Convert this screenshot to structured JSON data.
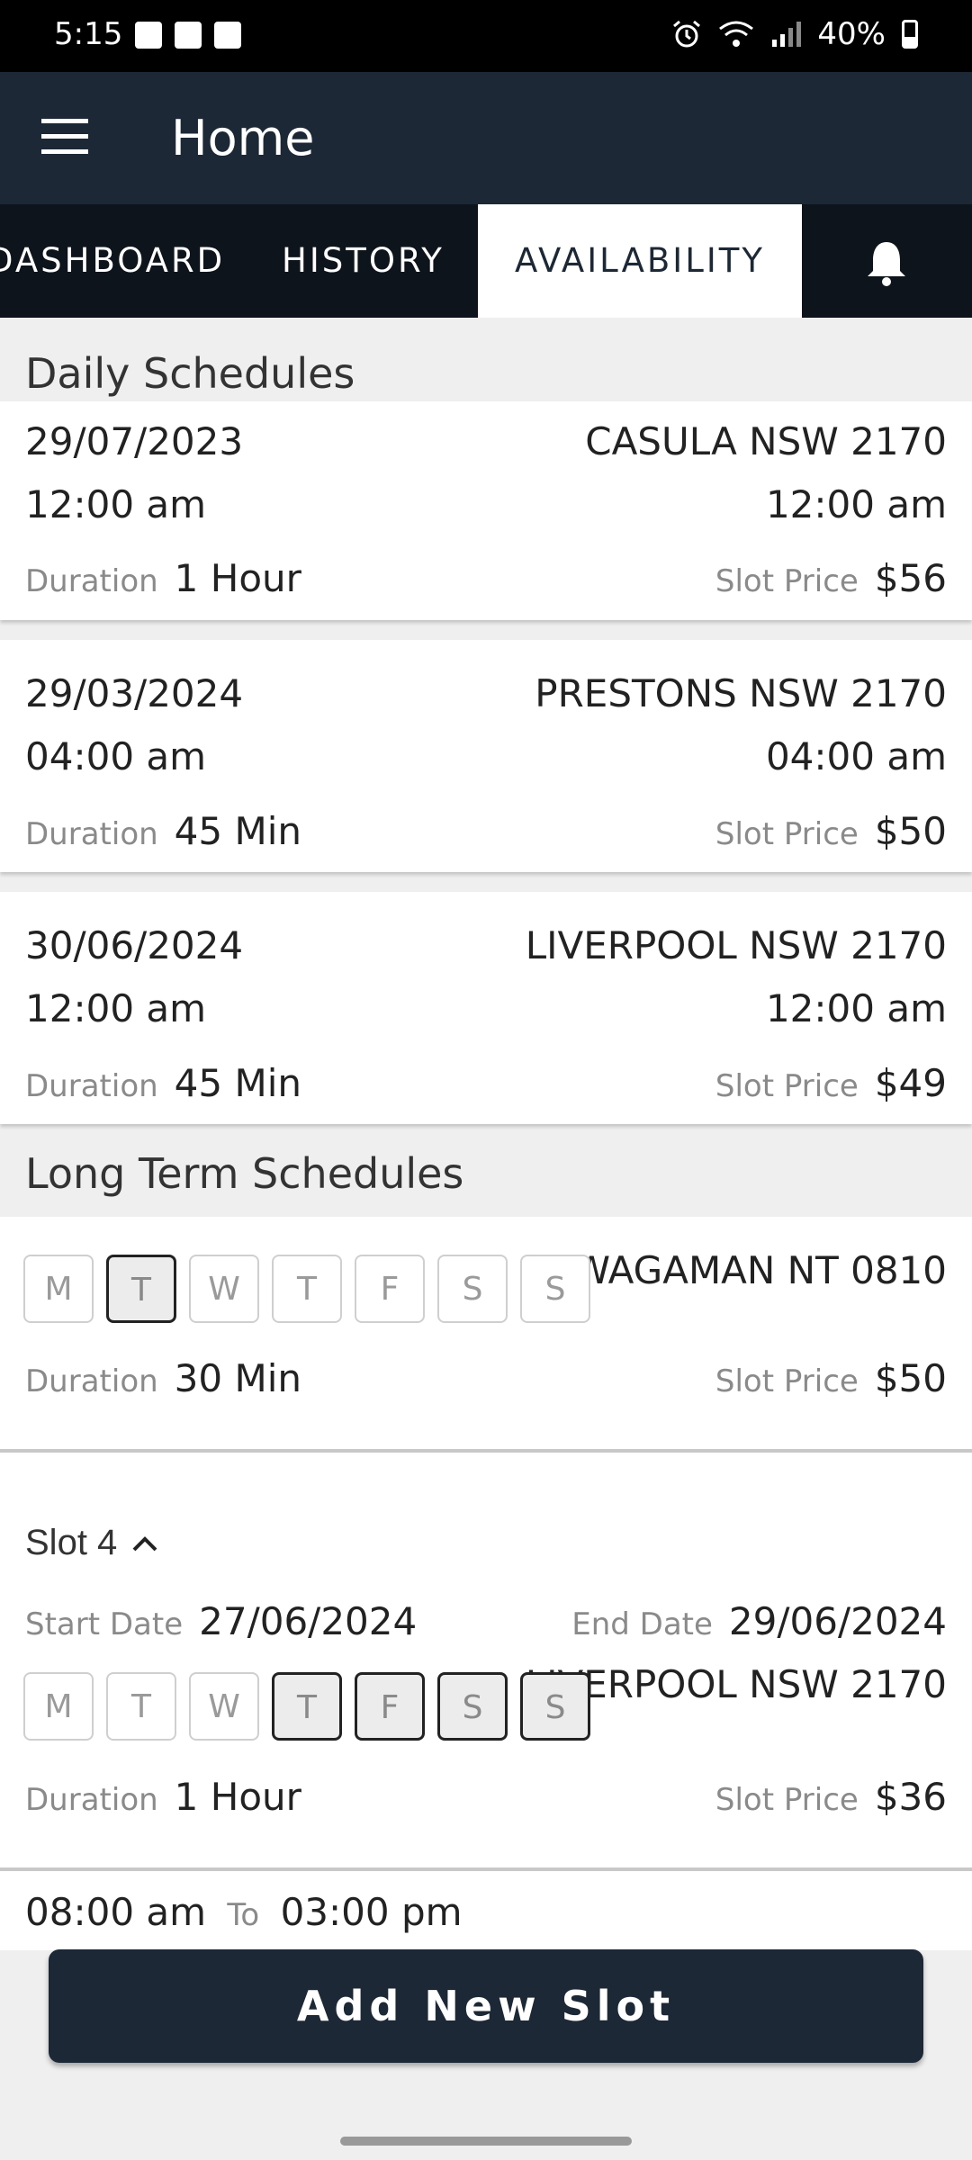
{
  "status_bar": {
    "time": "5:15",
    "battery": "40%"
  },
  "app_bar": {
    "title": "Home"
  },
  "tabs": [
    {
      "label": "DASHBOARD"
    },
    {
      "label": "HISTORY"
    },
    {
      "label": "AVAILABILITY"
    }
  ],
  "daily": {
    "title": "Daily Schedules",
    "duration_label": "Duration",
    "price_label": "Slot Price",
    "items": [
      {
        "date": "29/07/2023",
        "location": "CASULA NSW 2170",
        "start_time": "12:00 am",
        "end_time": "12:00 am",
        "duration": "1 Hour",
        "price": "$56"
      },
      {
        "date": "29/03/2024",
        "location": "PRESTONS NSW 2170",
        "start_time": "04:00 am",
        "end_time": "04:00 am",
        "duration": "45 Min",
        "price": "$50"
      },
      {
        "date": "30/06/2024",
        "location": "LIVERPOOL NSW 2170",
        "start_time": "12:00 am",
        "end_time": "12:00 am",
        "duration": "45 Min",
        "price": "$49"
      }
    ]
  },
  "long_term": {
    "title": "Long Term Schedules",
    "slot3": {
      "location": "WAGAMAN NT 0810",
      "days": [
        "M",
        "T",
        "W",
        "T",
        "F",
        "S",
        "S"
      ],
      "selected_days": [
        1
      ],
      "duration": "30 Min",
      "price": "$50"
    },
    "slot4": {
      "title": "Slot 4",
      "start_label": "Start Date",
      "start_date": "27/06/2024",
      "end_label": "End Date",
      "end_date": "29/06/2024",
      "location": "LIVERPOOL NSW 2170",
      "days": [
        "M",
        "T",
        "W",
        "T",
        "F",
        "S",
        "S"
      ],
      "selected_days": [
        3,
        4,
        5,
        6
      ],
      "duration": "1 Hour",
      "price": "$36",
      "time_from": "08:00 am",
      "to_label": "To",
      "time_to": "03:00 pm"
    }
  },
  "add_button": "Add New Slot",
  "colors": {
    "primary": "#1c2836",
    "tab_bar": "#0d141c"
  }
}
